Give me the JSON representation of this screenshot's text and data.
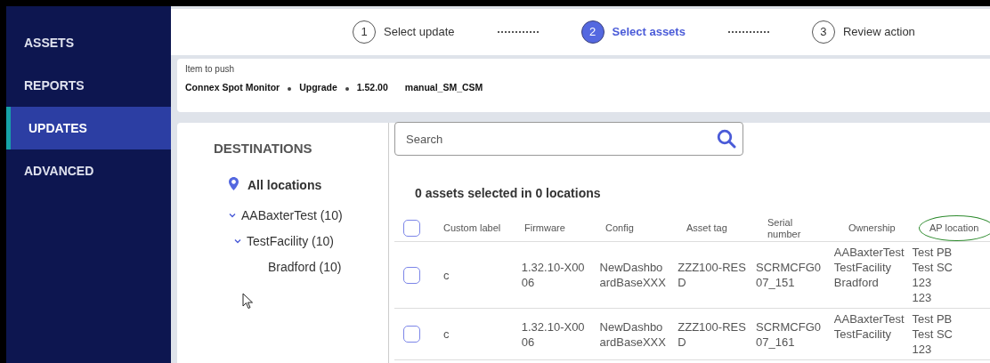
{
  "sidebar": {
    "items": [
      {
        "label": "ASSETS",
        "selected": false
      },
      {
        "label": "REPORTS",
        "selected": false
      },
      {
        "label": "UPDATES",
        "selected": true
      },
      {
        "label": "ADVANCED",
        "selected": false
      }
    ]
  },
  "stepper": {
    "steps": [
      {
        "number": "1",
        "label": "Select update",
        "selected": false
      },
      {
        "number": "2",
        "label": "Select assets",
        "selected": true
      },
      {
        "number": "3",
        "label": "Review action",
        "selected": false
      }
    ]
  },
  "item_to_push": {
    "label": "Item to push",
    "parts": [
      "Connex Spot Monitor",
      "Upgrade",
      "1.52.00"
    ],
    "extra": "manual_SM_CSM"
  },
  "destinations": {
    "title": "DESTINATIONS",
    "all_locations": "All locations",
    "tree": [
      {
        "label": "AABaxterTest (10)",
        "expanded": true,
        "children": [
          {
            "label": "TestFacility (10)",
            "expanded": true,
            "children": [
              {
                "label": "Bradford (10)"
              }
            ]
          }
        ]
      }
    ]
  },
  "search": {
    "placeholder": "Search"
  },
  "summary": "0 assets selected in 0 locations",
  "table": {
    "select_all_checked": false,
    "columns": [
      {
        "label": "Custom label",
        "circled": false
      },
      {
        "label": "Firmware",
        "circled": false
      },
      {
        "label": "Config",
        "circled": false
      },
      {
        "label": "Asset tag",
        "circled": false
      },
      {
        "label": "Serial number",
        "circled": false
      },
      {
        "label": "Ownership",
        "circled": false
      },
      {
        "label": "AP location",
        "circled": true
      }
    ],
    "rows": [
      {
        "checked": false,
        "cells": [
          "c",
          "1.32.10-X0006",
          "NewDashboardBaseXXX",
          "ZZZ100-RESD",
          "SCRMCFG007_151",
          [
            "AABaxterTest",
            "TestFacility",
            "Bradford"
          ],
          [
            "Test PB",
            "Test SC",
            "123",
            "123"
          ]
        ]
      },
      {
        "checked": false,
        "cells": [
          "c",
          "1.32.10-X0006",
          "NewDashboardBaseXXX",
          "ZZZ100-RESD",
          "SCRMCFG007_161",
          [
            "AABaxterTest",
            "TestFacility"
          ],
          [
            "Test PB",
            "Test SC",
            "123"
          ]
        ]
      }
    ]
  }
}
